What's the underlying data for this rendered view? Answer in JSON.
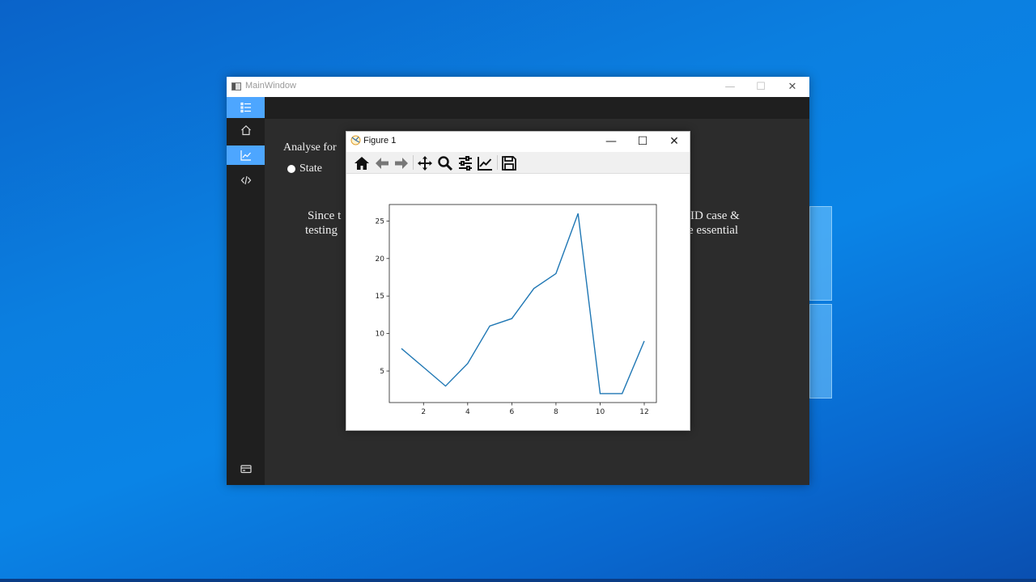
{
  "main_window": {
    "title": "MainWindow",
    "minimize": "—",
    "maximize": "☐",
    "close": "✕"
  },
  "sidebar": {
    "items": [
      {
        "icon": "list-icon",
        "active": true
      },
      {
        "icon": "home-icon",
        "active": false
      },
      {
        "icon": "chart-icon",
        "active": true
      },
      {
        "icon": "code-icon",
        "active": false
      },
      {
        "icon": "card-icon",
        "active": false
      }
    ]
  },
  "content": {
    "analyse_label": "Analyse for",
    "radio_state_label": "State",
    "paragraph_line1_left": "Since t",
    "paragraph_line2_left": "testing",
    "paragraph_line1_right": "ID case &",
    "paragraph_line2_right": "e essential"
  },
  "figure_window": {
    "title": "Figure 1",
    "minimize": "—",
    "maximize": "☐",
    "close": "✕",
    "toolbar": [
      "home-icon",
      "back-arrow-icon",
      "forward-arrow-icon",
      "pan-icon",
      "zoom-icon",
      "configure-subplots-icon",
      "edit-axis-icon",
      "save-icon"
    ]
  },
  "chart_data": {
    "type": "line",
    "x": [
      1,
      2,
      3,
      4,
      5,
      6,
      7,
      8,
      9,
      10,
      11,
      12
    ],
    "series": [
      {
        "values": [
          8,
          5.5,
          3,
          6,
          11,
          12,
          16,
          18,
          26,
          2,
          2,
          9
        ],
        "color": "#1f77b4"
      }
    ],
    "xticks": [
      2,
      4,
      6,
      8,
      10,
      12
    ],
    "yticks": [
      5,
      10,
      15,
      20,
      25
    ],
    "xlim": [
      0.45,
      12.55
    ],
    "ylim": [
      0.8,
      27.2
    ],
    "title": "",
    "xlabel": "",
    "ylabel": "",
    "grid": false
  }
}
